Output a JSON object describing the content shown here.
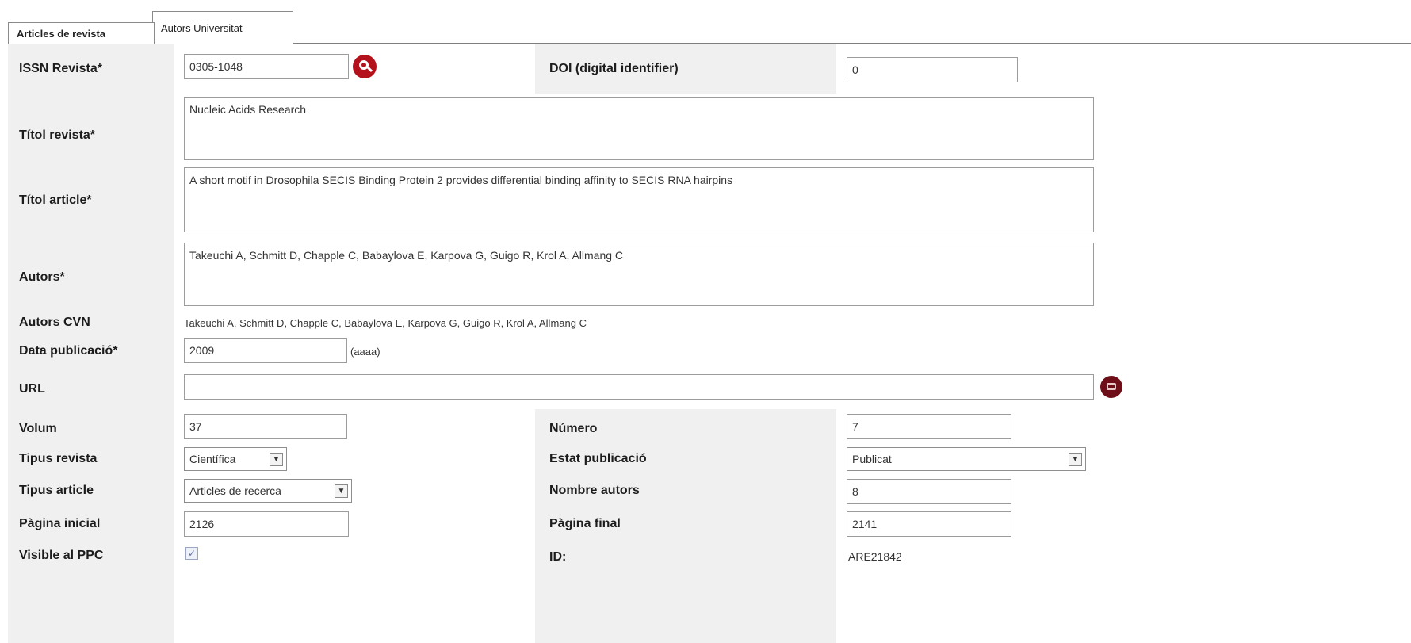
{
  "tabs": [
    {
      "label": "Articles de revista"
    },
    {
      "label": "Autors Universitat"
    }
  ],
  "form": {
    "issn": {
      "label": "ISSN Revista*",
      "value": "0305-1048"
    },
    "doi": {
      "label": "DOI (digital identifier)",
      "value": "0"
    },
    "titol_revista": {
      "label": "Títol revista*",
      "value": "Nucleic Acids Research"
    },
    "titol_article": {
      "label": "Títol article*",
      "value": "A short motif in Drosophila SECIS Binding Protein 2 provides differential binding affinity to SECIS RNA hairpins"
    },
    "autors": {
      "label": "Autors*",
      "value": "Takeuchi A, Schmitt D, Chapple C, Babaylova E, Karpova G, Guigo R, Krol A, Allmang C"
    },
    "autors_cvn": {
      "label": "Autors CVN",
      "value": "Takeuchi A, Schmitt D, Chapple C, Babaylova E, Karpova G, Guigo R, Krol A, Allmang C"
    },
    "data_publicacio": {
      "label": "Data publicació*",
      "value": "2009",
      "hint": "(aaaa)"
    },
    "url": {
      "label": "URL",
      "value": ""
    },
    "volum": {
      "label": "Volum",
      "value": "37"
    },
    "numero": {
      "label": "Número",
      "value": "7"
    },
    "tipus_revista": {
      "label": "Tipus revista",
      "value": "Científica"
    },
    "estat_publicacio": {
      "label": "Estat publicació",
      "value": "Publicat"
    },
    "tipus_article": {
      "label": "Tipus article",
      "value": "Articles de recerca"
    },
    "nombre_autors": {
      "label": "Nombre autors",
      "value": "8"
    },
    "pagina_inicial": {
      "label": "Pàgina inicial",
      "value": "2126"
    },
    "pagina_final": {
      "label": "Pàgina final",
      "value": "2141"
    },
    "visible_ppc": {
      "label": "Visible al PPC",
      "checked": true,
      "mark": "✓"
    },
    "id": {
      "label": "ID:",
      "value": "ARE21842"
    }
  },
  "icons": {
    "search": "search-icon",
    "url_action": "link-icon",
    "dropdown": "chevron-down-icon"
  },
  "colors": {
    "label_band": "#f0f0f0",
    "search_button": "#b3121c",
    "url_button": "#6e0e18"
  }
}
